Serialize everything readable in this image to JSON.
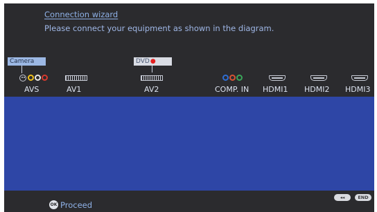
{
  "header": {
    "title": "Connection wizard",
    "instruction": "Please connect your equipment as shown in the diagram."
  },
  "devices": {
    "camera": "Camera",
    "dvd": "DVD"
  },
  "ports": {
    "avs": "AVS",
    "av1": "AV1",
    "av2": "AV2",
    "comp_in": "COMP. IN",
    "hdmi1": "HDMI1",
    "hdmi2": "HDMI2",
    "hdmi3": "HDMI3"
  },
  "footer": {
    "back_label": "◂◂",
    "end_label": "END",
    "ok_label": "OK",
    "proceed_label": "Proceed"
  },
  "colors": {
    "background": "#2b2b2e",
    "diagram_area": "#2e46a6",
    "accent_text": "#8fb2e8",
    "jack_yellow": "#f2c21b",
    "jack_white": "#e8e8e8",
    "jack_red": "#d93a2e",
    "component_blue": "#2f6ed4",
    "component_red": "#d95434",
    "component_green": "#3aa85a"
  },
  "icons": {
    "smiley_jack": "smiley-jack-icon",
    "scart": "scart-port-icon",
    "hdmi": "hdmi-port-icon",
    "ok": "ok-button-icon"
  }
}
